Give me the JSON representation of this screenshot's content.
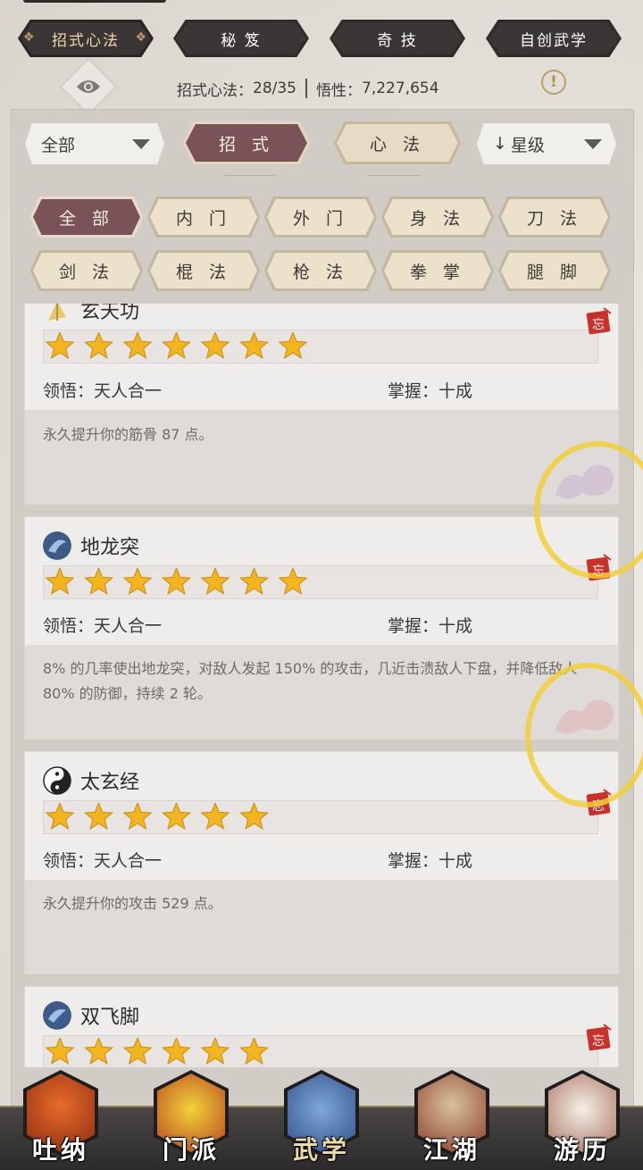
{
  "top_tabs": [
    {
      "label": "招式心法",
      "active": true
    },
    {
      "label": "秘 笈",
      "active": false
    },
    {
      "label": "奇 技",
      "active": false
    },
    {
      "label": "自创武学",
      "active": false
    }
  ],
  "stats": {
    "skills_label": "招式心法：",
    "skills_value": "28/35",
    "insight_label": "悟性：",
    "insight_value": "7,227,654"
  },
  "info_icon": "!",
  "filters": {
    "scope": "全部",
    "mode_active": "招 式",
    "mode_other": "心 法",
    "sort": "星级",
    "sort_arrow": "↓"
  },
  "categories": [
    {
      "label": "全 部",
      "selected": true
    },
    {
      "label": "内 门",
      "selected": false
    },
    {
      "label": "外 门",
      "selected": false
    },
    {
      "label": "身 法",
      "selected": false
    },
    {
      "label": "刀 法",
      "selected": false
    },
    {
      "label": "剑 法",
      "selected": false
    },
    {
      "label": "棍 法",
      "selected": false
    },
    {
      "label": "枪 法",
      "selected": false
    },
    {
      "label": "拳 掌",
      "selected": false
    },
    {
      "label": "腿 脚",
      "selected": false
    }
  ],
  "skills": [
    {
      "name": "玄天功",
      "icon": "golden-leaf-icon",
      "stars": 7,
      "comprehension_label": "领悟：",
      "comprehension": "天人合一",
      "mastery_label": "掌握：",
      "mastery": "十成",
      "description": "永久提升你的筋骨 87 点。"
    },
    {
      "name": "地龙突",
      "icon": "dragon-spear-icon",
      "stars": 7,
      "comprehension_label": "领悟：",
      "comprehension": "天人合一",
      "mastery_label": "掌握：",
      "mastery": "十成",
      "description": "8% 的几率使出地龙突，对敌人发起 150% 的攻击，几近击溃敌人下盘，并降低敌人 80% 的防御，持续 2 轮。"
    },
    {
      "name": "太玄经",
      "icon": "yin-yang-icon",
      "stars": 6,
      "comprehension_label": "领悟：",
      "comprehension": "天人合一",
      "mastery_label": "掌握：",
      "mastery": "十成",
      "description": "永久提升你的攻击 529 点。"
    },
    {
      "name": "双飞脚",
      "icon": "flying-kick-icon",
      "stars": 6,
      "comprehension_label": "",
      "comprehension": "",
      "mastery_label": "",
      "mastery": "",
      "description": ""
    }
  ],
  "forget_label": "忘",
  "bottom_nav": [
    {
      "label": "吐纳",
      "active": false
    },
    {
      "label": "门派",
      "active": false
    },
    {
      "label": "武学",
      "active": true
    },
    {
      "label": "江湖",
      "active": false
    },
    {
      "label": "游历",
      "active": false
    }
  ],
  "colors": {
    "accent_wine": "#7a5358",
    "tab_dark": "#2f2c2c",
    "star_gold": "#f2b520",
    "highlight_ring": "#f2cf3a",
    "forget_red": "#c8322c"
  }
}
